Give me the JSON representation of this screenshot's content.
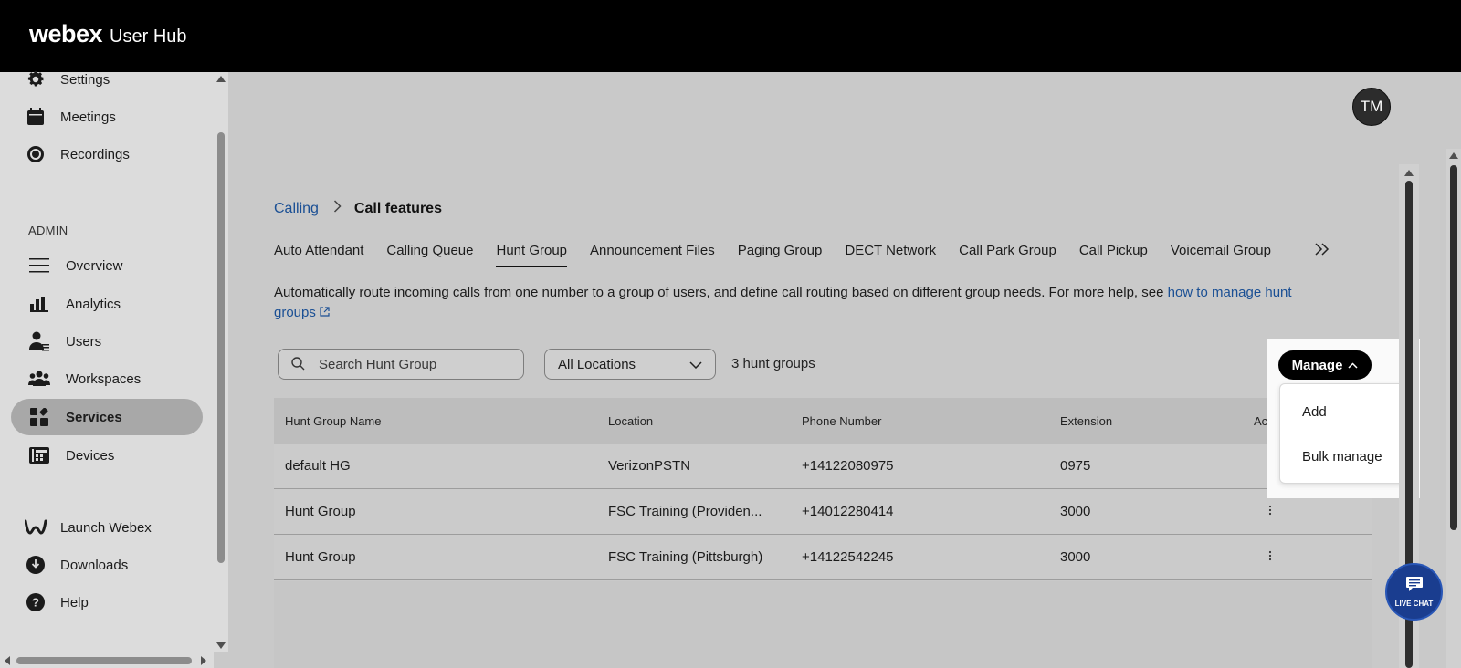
{
  "topbar": {
    "brand": "webex",
    "product": "User Hub"
  },
  "sidebar": {
    "top_items": [
      {
        "label": "Settings",
        "icon": "gear-icon"
      },
      {
        "label": "Meetings",
        "icon": "calendar-icon"
      },
      {
        "label": "Recordings",
        "icon": "record-icon"
      }
    ],
    "admin_label": "ADMIN",
    "admin_items": [
      {
        "label": "Overview",
        "icon": "menu-icon"
      },
      {
        "label": "Analytics",
        "icon": "analytics-icon"
      },
      {
        "label": "Users",
        "icon": "users-icon"
      },
      {
        "label": "Workspaces",
        "icon": "workspaces-icon"
      },
      {
        "label": "Services",
        "icon": "services-icon",
        "active": true
      },
      {
        "label": "Devices",
        "icon": "devices-icon"
      }
    ],
    "bottom_items": [
      {
        "label": "Launch Webex",
        "icon": "webex-logo-icon"
      },
      {
        "label": "Downloads",
        "icon": "download-icon"
      },
      {
        "label": "Help",
        "icon": "help-icon"
      }
    ]
  },
  "header": {
    "avatar_initials": "TM"
  },
  "breadcrumb": {
    "parent": "Calling",
    "current": "Call features"
  },
  "tabs": [
    {
      "label": "Auto Attendant"
    },
    {
      "label": "Calling Queue"
    },
    {
      "label": "Hunt Group",
      "active": true
    },
    {
      "label": "Announcement Files"
    },
    {
      "label": "Paging Group"
    },
    {
      "label": "DECT Network"
    },
    {
      "label": "Call Park Group"
    },
    {
      "label": "Call Pickup"
    },
    {
      "label": "Voicemail Group"
    }
  ],
  "description": {
    "text": "Automatically route incoming calls from one number to a group of users, and define call routing based on different group needs. For more help, see ",
    "link": "how to manage hunt groups"
  },
  "toolbar": {
    "search_placeholder": "Search Hunt Group",
    "location_value": "All Locations",
    "count_text": "3 hunt groups",
    "manage_label": "Manage"
  },
  "manage_menu": {
    "items": [
      "Add",
      "Bulk manage"
    ]
  },
  "table": {
    "columns": [
      "Hunt Group Name",
      "Location",
      "Phone Number",
      "Extension",
      "Actio"
    ],
    "rows": [
      {
        "name": "default HG",
        "location": "VerizonPSTN",
        "phone": "+14122080975",
        "extension": "0975"
      },
      {
        "name": "Hunt Group",
        "location": "FSC Training (Providen...",
        "phone": "+14012280414",
        "extension": "3000"
      },
      {
        "name": "Hunt Group",
        "location": "FSC Training (Pittsburgh)",
        "phone": "+14122542245",
        "extension": "3000"
      }
    ]
  },
  "live_chat": {
    "label": "LIVE CHAT"
  },
  "colors": {
    "topbar": "#000000",
    "link": "#1a4f94",
    "live_chat": "#1a3d8f",
    "active_nav": "#a8a8a8"
  }
}
